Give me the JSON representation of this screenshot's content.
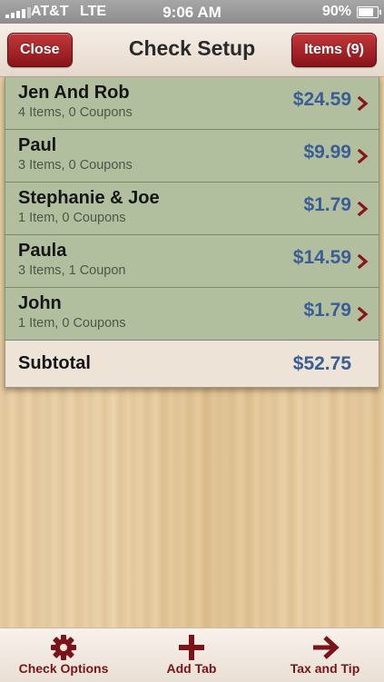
{
  "status_bar": {
    "carrier": "AT&T",
    "network": "LTE",
    "time": "9:06 AM",
    "battery": "90%",
    "battery_level": 0.9
  },
  "nav": {
    "close_label": "Close",
    "title": "Check Setup",
    "items_label": "Items (9)"
  },
  "tabs": [
    {
      "name": "Jen And Rob",
      "detail": "4 Items, 0 Coupons",
      "amount": "$24.59"
    },
    {
      "name": "Paul",
      "detail": "3 Items, 0 Coupons",
      "amount": "$9.99"
    },
    {
      "name": "Stephanie & Joe",
      "detail": "1 Item, 0 Coupons",
      "amount": "$1.79"
    },
    {
      "name": "Paula",
      "detail": "3 Items, 1 Coupon",
      "amount": "$14.59"
    },
    {
      "name": "John",
      "detail": "1 Item, 0 Coupons",
      "amount": "$1.79"
    }
  ],
  "subtotal": {
    "label": "Subtotal",
    "amount": "$52.75"
  },
  "toolbar": {
    "check_options_label": "Check Options",
    "check_options_icon": "gear-icon",
    "add_tab_label": "Add Tab",
    "add_tab_icon": "plus-icon",
    "tax_tip_label": "Tax and Tip",
    "tax_tip_icon": "arrow-right-icon"
  },
  "colors": {
    "accent_red": "#8a1419",
    "amount_blue": "#3a5d96",
    "row_green": "#b2bf9e"
  }
}
